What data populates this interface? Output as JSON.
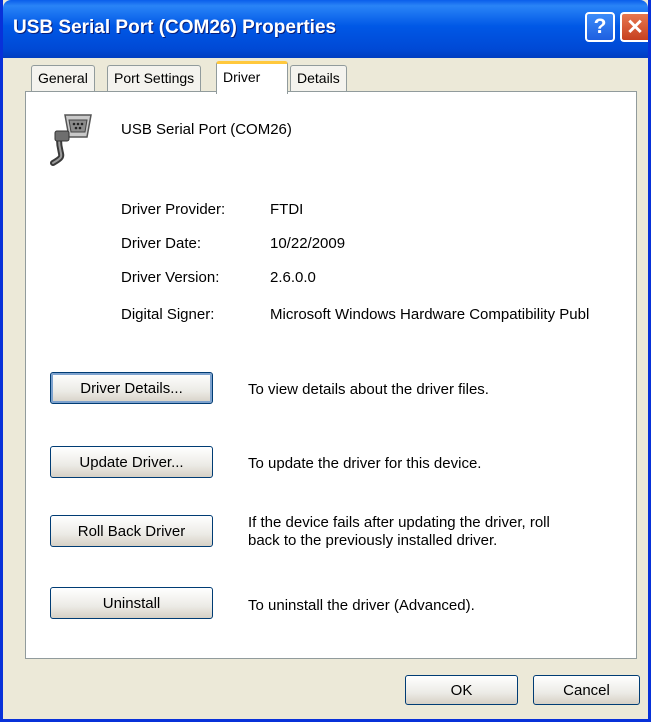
{
  "window": {
    "title": "USB Serial Port (COM26) Properties",
    "help_label": "?",
    "close_label": "✕"
  },
  "tabs": [
    {
      "label": "General"
    },
    {
      "label": "Port Settings"
    },
    {
      "label": "Driver"
    },
    {
      "label": "Details"
    }
  ],
  "active_tab": "Driver",
  "device": {
    "name": "USB Serial Port (COM26)",
    "icon": "serial-port-icon"
  },
  "driver_info": {
    "provider_label": "Driver Provider:",
    "provider_value": "FTDI",
    "date_label": "Driver Date:",
    "date_value": "10/22/2009",
    "version_label": "Driver Version:",
    "version_value": "2.6.0.0",
    "signer_label": "Digital Signer:",
    "signer_value": "Microsoft Windows Hardware Compatibility Publ"
  },
  "actions": {
    "details_label": "Driver Details...",
    "details_desc": "To view details about the driver files.",
    "update_label": "Update Driver...",
    "update_desc": "To update the driver for this device.",
    "rollback_label": "Roll Back Driver",
    "rollback_desc_1": "If the device fails after updating the driver, roll",
    "rollback_desc_2": "back to the previously installed driver.",
    "uninstall_label": "Uninstall",
    "uninstall_desc": "To uninstall the driver (Advanced)."
  },
  "footer": {
    "ok_label": "OK",
    "cancel_label": "Cancel"
  },
  "colors": {
    "titlebar": "#0058E6",
    "face": "#ECE9D8",
    "active_tab_accent": "#FFC83C",
    "border": "#919B9C"
  }
}
